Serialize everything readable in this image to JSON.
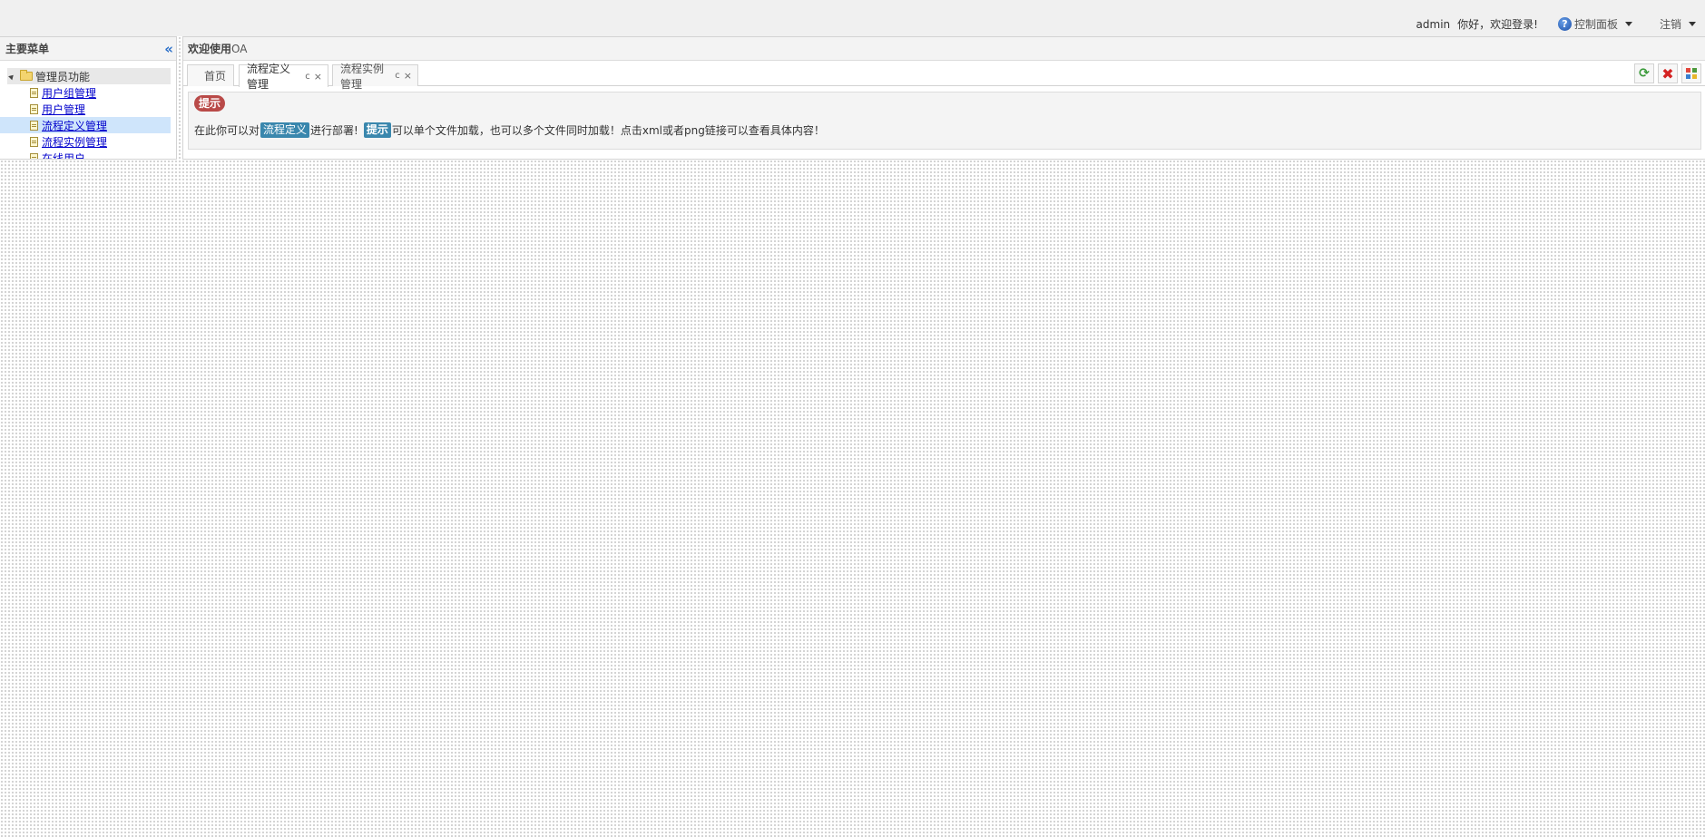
{
  "header": {
    "username": "admin",
    "greeting": "你好，欢迎登录!",
    "control_panel_label": "控制面板",
    "logout_label": "注销"
  },
  "sidebar": {
    "title": "主要菜单",
    "collapse_icon": "double-chevron-left-icon",
    "root": {
      "label": "管理员功能"
    },
    "items": [
      {
        "label": "用户组管理"
      },
      {
        "label": "用户管理"
      },
      {
        "label": "流程定义管理",
        "selected": true
      },
      {
        "label": "流程实例管理"
      },
      {
        "label": "在线用户"
      }
    ]
  },
  "main": {
    "title_prefix": "欢迎使用",
    "title_suffix": "OA",
    "tabs": [
      {
        "label": "首页"
      },
      {
        "label": "流程定义管理",
        "active": true,
        "refresh": "c",
        "close": "×"
      },
      {
        "label": "流程实例管理",
        "refresh": "c",
        "close": "×"
      }
    ],
    "tools": [
      "refresh-all-icon",
      "close-all-icon",
      "grid-icon"
    ],
    "tip": {
      "badge": "提示",
      "text_before": "在此你可以对",
      "highlight1": "流程定义",
      "text_middle": "进行部署!",
      "highlight2": "提示",
      "text_after": "可以单个文件加载，也可以多个文件同时加载！点击xml或者png链接可以查看具体内容！"
    }
  },
  "colors": {
    "accent_blue": "#3a87ad",
    "badge_red": "#b94a48",
    "link_blue": "#0000cc",
    "selected_row": "#cfe5fb"
  }
}
